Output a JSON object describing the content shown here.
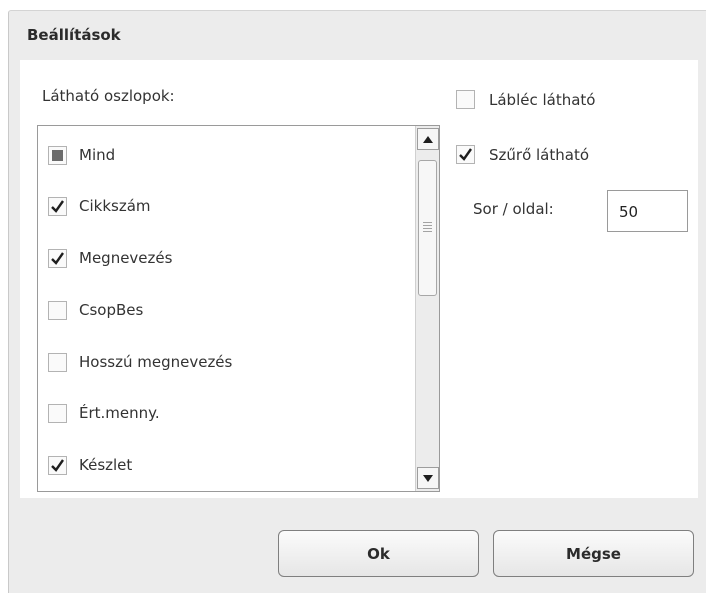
{
  "dialog": {
    "title": "Beállítások",
    "columns_label": "Látható oszlopok:",
    "columns": [
      {
        "label": "Mind",
        "state": "indeterminate"
      },
      {
        "label": "Cikkszám",
        "state": "checked"
      },
      {
        "label": "Megnevezés",
        "state": "checked"
      },
      {
        "label": "CsopBes",
        "state": "unchecked"
      },
      {
        "label": "Hosszú megnevezés",
        "state": "unchecked"
      },
      {
        "label": "Ért.menny.",
        "state": "unchecked"
      },
      {
        "label": "Készlet",
        "state": "checked"
      }
    ],
    "footer_visible": {
      "label": "Lábléc látható",
      "checked": false
    },
    "filter_visible": {
      "label": "Szűrő látható",
      "checked": true
    },
    "rows_per_page": {
      "label": "Sor / oldal:",
      "value": "50"
    },
    "ok_label": "Ok",
    "cancel_label": "Mégse"
  },
  "colors": {
    "dialog_bg": "#ececec",
    "panel_bg": "#ffffff",
    "text": "#333333",
    "border": "#9a9a9a"
  }
}
